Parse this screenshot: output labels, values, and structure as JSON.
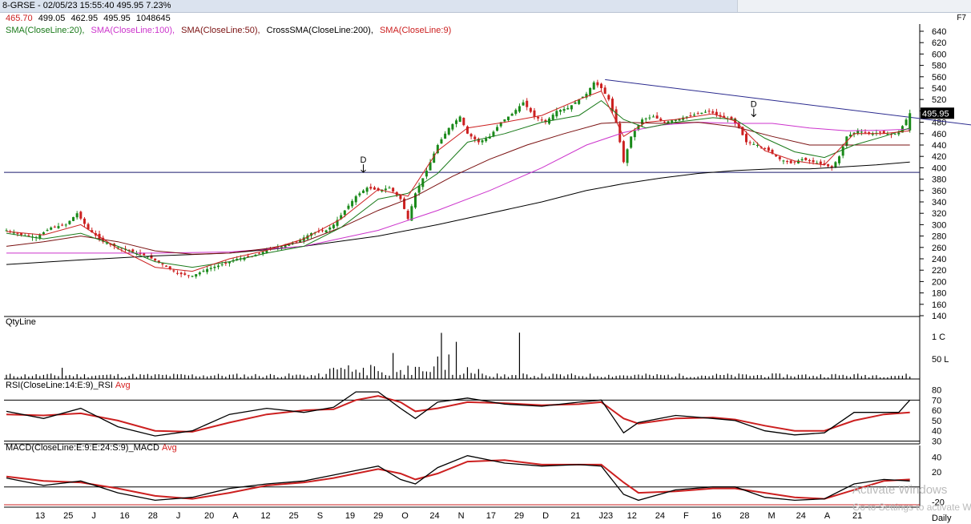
{
  "header": {
    "symbol": "8-GRSE",
    "datetime": "02/05/23 15:55:40",
    "last": "495.95",
    "change_pct": "7.23%",
    "open": "465.70",
    "high": "499.05",
    "low": "462.95",
    "close": "495.95",
    "volume": "1048645",
    "shortcut": "F7",
    "period": "Daily"
  },
  "legend": [
    {
      "label": "SMA(CloseLine:20),",
      "color": "#1a7a1a"
    },
    {
      "label": "SMA(CloseLine:100),",
      "color": "#cc33cc"
    },
    {
      "label": "SMA(CloseLine:50),",
      "color": "#7a1010"
    },
    {
      "label": "CrossSMA(CloseLine:200),",
      "color": "#000000"
    },
    {
      "label": "SMA(CloseLine:9)",
      "color": "#cc2020"
    }
  ],
  "panels": {
    "qty": {
      "label": "QtyLine"
    },
    "rsi": {
      "label": "RSI(CloseLine:14:E:9)_RSI",
      "avg": "Avg"
    },
    "macd": {
      "label": "MACD(CloseLine:E:9:E:24:S:9)_MACD",
      "avg": "Avg"
    }
  },
  "chart_data": {
    "type": "candlestick",
    "price_axis": {
      "min": 140,
      "max": 640,
      "ticks": [
        "640",
        "620",
        "600",
        "580",
        "560",
        "540",
        "520",
        "500",
        "480",
        "460",
        "440",
        "420",
        "400",
        "380",
        "360",
        "340",
        "320",
        "300",
        "280",
        "260",
        "240",
        "220",
        "200",
        "180",
        "160",
        "140"
      ]
    },
    "last_price_label": "495.95",
    "annotations": [
      "D",
      "D"
    ],
    "horizontal_level": 392,
    "x_labels": [
      "13",
      "25",
      "J",
      "16",
      "28",
      "J",
      "20",
      "A",
      "12",
      "25",
      "S",
      "19",
      "29",
      "O",
      "24",
      "N",
      "17",
      "29",
      "D",
      "21",
      "J23",
      "12",
      "24",
      "F",
      "16",
      "28",
      "M",
      "24",
      "A",
      "21"
    ],
    "price_series": [
      [
        0,
        290
      ],
      [
        4,
        282
      ],
      [
        8,
        278
      ],
      [
        12,
        295
      ],
      [
        16,
        300
      ],
      [
        19,
        320
      ],
      [
        22,
        292
      ],
      [
        26,
        270
      ],
      [
        30,
        260
      ],
      [
        34,
        252
      ],
      [
        38,
        244
      ],
      [
        42,
        230
      ],
      [
        46,
        214
      ],
      [
        50,
        210
      ],
      [
        54,
        222
      ],
      [
        58,
        230
      ],
      [
        62,
        240
      ],
      [
        66,
        244
      ],
      [
        70,
        255
      ],
      [
        74,
        262
      ],
      [
        78,
        270
      ],
      [
        82,
        285
      ],
      [
        86,
        290
      ],
      [
        88,
        300
      ],
      [
        91,
        325
      ],
      [
        94,
        350
      ],
      [
        97,
        365
      ],
      [
        100,
        360
      ],
      [
        103,
        365
      ],
      [
        106,
        345
      ],
      [
        108,
        310
      ],
      [
        110,
        355
      ],
      [
        113,
        395
      ],
      [
        116,
        440
      ],
      [
        119,
        470
      ],
      [
        122,
        490
      ],
      [
        124,
        460
      ],
      [
        127,
        445
      ],
      [
        130,
        455
      ],
      [
        133,
        480
      ],
      [
        136,
        495
      ],
      [
        139,
        515
      ],
      [
        142,
        490
      ],
      [
        145,
        480
      ],
      [
        148,
        500
      ],
      [
        151,
        505
      ],
      [
        154,
        520
      ],
      [
        156,
        530
      ],
      [
        158,
        550
      ],
      [
        160,
        540
      ],
      [
        162,
        520
      ],
      [
        164,
        480
      ],
      [
        166,
        410
      ],
      [
        168,
        455
      ],
      [
        171,
        485
      ],
      [
        174,
        490
      ],
      [
        177,
        480
      ],
      [
        180,
        485
      ],
      [
        183,
        490
      ],
      [
        186,
        495
      ],
      [
        189,
        500
      ],
      [
        192,
        490
      ],
      [
        195,
        485
      ],
      [
        197,
        470
      ],
      [
        199,
        445
      ],
      [
        202,
        440
      ],
      [
        205,
        430
      ],
      [
        208,
        415
      ],
      [
        211,
        408
      ],
      [
        214,
        415
      ],
      [
        217,
        410
      ],
      [
        220,
        405
      ],
      [
        222,
        400
      ],
      [
        224,
        420
      ],
      [
        226,
        455
      ],
      [
        229,
        465
      ],
      [
        232,
        460
      ],
      [
        235,
        462
      ],
      [
        238,
        458
      ],
      [
        240,
        462
      ],
      [
        243,
        496
      ]
    ],
    "sma20": [
      [
        0,
        285
      ],
      [
        10,
        275
      ],
      [
        20,
        285
      ],
      [
        30,
        262
      ],
      [
        40,
        235
      ],
      [
        50,
        225
      ],
      [
        60,
        235
      ],
      [
        70,
        250
      ],
      [
        80,
        262
      ],
      [
        90,
        295
      ],
      [
        100,
        345
      ],
      [
        108,
        355
      ],
      [
        116,
        390
      ],
      [
        124,
        445
      ],
      [
        134,
        460
      ],
      [
        144,
        480
      ],
      [
        154,
        492
      ],
      [
        160,
        518
      ],
      [
        166,
        485
      ],
      [
        172,
        470
      ],
      [
        180,
        480
      ],
      [
        190,
        488
      ],
      [
        196,
        485
      ],
      [
        204,
        452
      ],
      [
        212,
        428
      ],
      [
        220,
        418
      ],
      [
        228,
        440
      ],
      [
        236,
        455
      ],
      [
        243,
        470
      ]
    ],
    "sma100": [
      [
        0,
        250
      ],
      [
        20,
        250
      ],
      [
        40,
        250
      ],
      [
        60,
        252
      ],
      [
        80,
        262
      ],
      [
        100,
        290
      ],
      [
        116,
        325
      ],
      [
        130,
        360
      ],
      [
        144,
        400
      ],
      [
        156,
        440
      ],
      [
        166,
        462
      ],
      [
        176,
        475
      ],
      [
        186,
        480
      ],
      [
        196,
        478
      ],
      [
        206,
        478
      ],
      [
        216,
        470
      ],
      [
        226,
        465
      ],
      [
        236,
        466
      ],
      [
        243,
        468
      ]
    ],
    "sma50": [
      [
        0,
        262
      ],
      [
        10,
        270
      ],
      [
        20,
        280
      ],
      [
        30,
        270
      ],
      [
        40,
        254
      ],
      [
        50,
        248
      ],
      [
        60,
        250
      ],
      [
        70,
        258
      ],
      [
        80,
        270
      ],
      [
        90,
        295
      ],
      [
        100,
        325
      ],
      [
        110,
        350
      ],
      [
        120,
        385
      ],
      [
        130,
        415
      ],
      [
        140,
        440
      ],
      [
        150,
        460
      ],
      [
        160,
        478
      ],
      [
        166,
        480
      ],
      [
        176,
        478
      ],
      [
        186,
        480
      ],
      [
        196,
        472
      ],
      [
        206,
        455
      ],
      [
        216,
        440
      ],
      [
        226,
        440
      ],
      [
        236,
        440
      ],
      [
        243,
        440
      ]
    ],
    "sma200": [
      [
        0,
        230
      ],
      [
        20,
        238
      ],
      [
        40,
        245
      ],
      [
        60,
        250
      ],
      [
        80,
        262
      ],
      [
        100,
        280
      ],
      [
        116,
        300
      ],
      [
        130,
        320
      ],
      [
        144,
        340
      ],
      [
        156,
        360
      ],
      [
        166,
        372
      ],
      [
        176,
        382
      ],
      [
        186,
        390
      ],
      [
        196,
        395
      ],
      [
        206,
        398
      ],
      [
        216,
        398
      ],
      [
        226,
        402
      ],
      [
        234,
        405
      ],
      [
        243,
        410
      ]
    ],
    "sma9": [
      [
        0,
        288
      ],
      [
        10,
        282
      ],
      [
        20,
        300
      ],
      [
        30,
        258
      ],
      [
        40,
        225
      ],
      [
        50,
        218
      ],
      [
        60,
        240
      ],
      [
        70,
        255
      ],
      [
        80,
        275
      ],
      [
        90,
        310
      ],
      [
        100,
        362
      ],
      [
        108,
        350
      ],
      [
        116,
        430
      ],
      [
        124,
        470
      ],
      [
        134,
        480
      ],
      [
        144,
        492
      ],
      [
        154,
        520
      ],
      [
        160,
        535
      ],
      [
        166,
        455
      ],
      [
        172,
        480
      ],
      [
        180,
        485
      ],
      [
        190,
        495
      ],
      [
        196,
        482
      ],
      [
        204,
        430
      ],
      [
        212,
        412
      ],
      [
        220,
        405
      ],
      [
        228,
        460
      ],
      [
        236,
        460
      ],
      [
        243,
        465
      ]
    ],
    "trendline": [
      [
        161,
        555
      ],
      [
        260,
        475
      ]
    ],
    "qty": {
      "axis": [
        "1 C",
        "50 L"
      ]
    },
    "rsi": {
      "axis": [
        "80",
        "70",
        "60",
        "50",
        "40",
        "30"
      ],
      "levels": [
        70,
        30
      ],
      "rsi": [
        [
          0,
          59
        ],
        [
          10,
          52
        ],
        [
          20,
          62
        ],
        [
          30,
          44
        ],
        [
          40,
          35
        ],
        [
          50,
          40
        ],
        [
          60,
          56
        ],
        [
          70,
          62
        ],
        [
          80,
          58
        ],
        [
          88,
          63
        ],
        [
          94,
          78
        ],
        [
          100,
          78
        ],
        [
          106,
          62
        ],
        [
          110,
          52
        ],
        [
          116,
          68
        ],
        [
          124,
          72
        ],
        [
          134,
          66
        ],
        [
          144,
          64
        ],
        [
          154,
          68
        ],
        [
          160,
          70
        ],
        [
          166,
          38
        ],
        [
          170,
          48
        ],
        [
          180,
          55
        ],
        [
          190,
          52
        ],
        [
          196,
          50
        ],
        [
          204,
          40
        ],
        [
          212,
          36
        ],
        [
          220,
          38
        ],
        [
          228,
          58
        ],
        [
          236,
          58
        ],
        [
          240,
          58
        ],
        [
          243,
          70
        ]
      ],
      "avg": [
        [
          0,
          56
        ],
        [
          10,
          55
        ],
        [
          20,
          57
        ],
        [
          30,
          50
        ],
        [
          40,
          40
        ],
        [
          50,
          39
        ],
        [
          60,
          48
        ],
        [
          70,
          56
        ],
        [
          80,
          60
        ],
        [
          88,
          61
        ],
        [
          94,
          70
        ],
        [
          100,
          74
        ],
        [
          106,
          68
        ],
        [
          110,
          59
        ],
        [
          116,
          62
        ],
        [
          124,
          68
        ],
        [
          134,
          67
        ],
        [
          144,
          65
        ],
        [
          154,
          66
        ],
        [
          160,
          68
        ],
        [
          166,
          52
        ],
        [
          170,
          47
        ],
        [
          180,
          52
        ],
        [
          190,
          53
        ],
        [
          196,
          51
        ],
        [
          204,
          45
        ],
        [
          212,
          40
        ],
        [
          220,
          40
        ],
        [
          228,
          50
        ],
        [
          236,
          56
        ],
        [
          243,
          58
        ]
      ]
    },
    "macd": {
      "axis": [
        "40",
        "20",
        "-20"
      ],
      "macd": [
        [
          0,
          12
        ],
        [
          10,
          2
        ],
        [
          20,
          8
        ],
        [
          30,
          -8
        ],
        [
          40,
          -18
        ],
        [
          50,
          -14
        ],
        [
          60,
          -2
        ],
        [
          70,
          4
        ],
        [
          80,
          8
        ],
        [
          88,
          16
        ],
        [
          94,
          22
        ],
        [
          100,
          28
        ],
        [
          106,
          10
        ],
        [
          110,
          4
        ],
        [
          116,
          26
        ],
        [
          124,
          42
        ],
        [
          134,
          32
        ],
        [
          144,
          28
        ],
        [
          154,
          30
        ],
        [
          160,
          28
        ],
        [
          166,
          -10
        ],
        [
          170,
          -18
        ],
        [
          180,
          -4
        ],
        [
          190,
          0
        ],
        [
          196,
          0
        ],
        [
          204,
          -14
        ],
        [
          212,
          -18
        ],
        [
          220,
          -16
        ],
        [
          228,
          4
        ],
        [
          236,
          10
        ],
        [
          243,
          8
        ]
      ],
      "avg": [
        [
          0,
          14
        ],
        [
          10,
          8
        ],
        [
          20,
          6
        ],
        [
          30,
          -2
        ],
        [
          40,
          -12
        ],
        [
          50,
          -16
        ],
        [
          60,
          -8
        ],
        [
          70,
          2
        ],
        [
          80,
          6
        ],
        [
          88,
          12
        ],
        [
          94,
          18
        ],
        [
          100,
          24
        ],
        [
          106,
          18
        ],
        [
          110,
          10
        ],
        [
          116,
          18
        ],
        [
          124,
          34
        ],
        [
          134,
          36
        ],
        [
          144,
          30
        ],
        [
          154,
          30
        ],
        [
          160,
          30
        ],
        [
          166,
          6
        ],
        [
          170,
          -8
        ],
        [
          180,
          -6
        ],
        [
          190,
          -2
        ],
        [
          196,
          -2
        ],
        [
          204,
          -8
        ],
        [
          212,
          -14
        ],
        [
          220,
          -16
        ],
        [
          228,
          -4
        ],
        [
          236,
          8
        ],
        [
          243,
          10
        ]
      ]
    }
  },
  "watermark": {
    "line1": "Activate Windows",
    "line2": "Go to Settings to activate Windows."
  }
}
